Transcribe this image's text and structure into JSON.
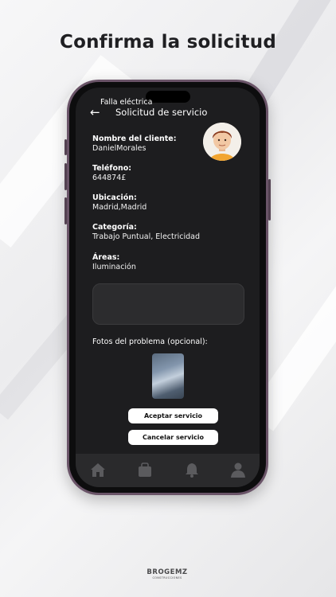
{
  "headline": "Confirma la solicitud",
  "appbar": {
    "title": "Solicitud de servicio"
  },
  "fields": [
    {
      "label": "Nombre del cliente:",
      "value": "DanielMorales"
    },
    {
      "label": "Teléfono:",
      "value": "644874£"
    },
    {
      "label": "Ubicación:",
      "value": "Madrid,Madrid"
    },
    {
      "label": "Categoría:",
      "value": "Trabajo Puntual, Electricidad"
    },
    {
      "label": "Áreas:",
      "value": "Iluminación"
    }
  ],
  "description": "Falla eléctrica",
  "photos_label": "Fotos del problema (opcional):",
  "buttons": {
    "accept": "Aceptar servicio",
    "cancel": "Cancelar servicio"
  },
  "nav": [
    "home-icon",
    "bag-icon",
    "bell-icon",
    "user-icon"
  ],
  "footer": {
    "brand": "BROGEMZ",
    "tagline": "CONSTRUCCIONES"
  },
  "colors": {
    "screen": "#1d1d1f",
    "nav": "#2a2a2c",
    "phone_frame": "#6a5468",
    "text": "#ffffff"
  }
}
